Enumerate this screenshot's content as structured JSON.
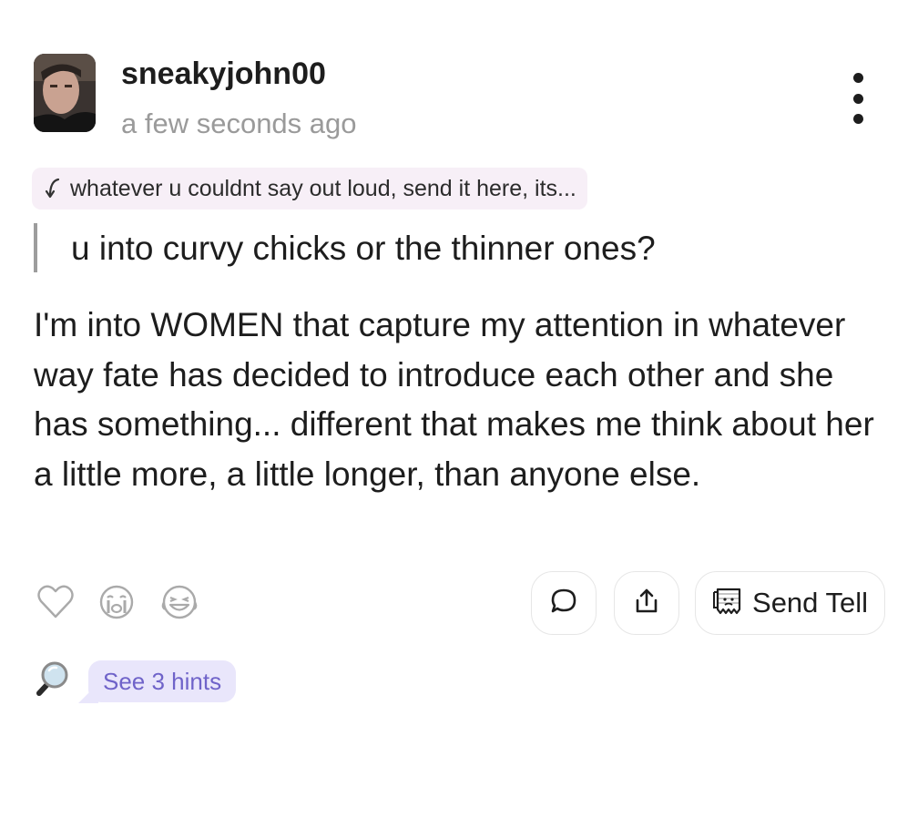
{
  "post": {
    "username": "sneakyjohn00",
    "timestamp": "a few seconds ago",
    "reply_prompt": "whatever u couldnt say out loud, send it here, its...",
    "question": "u into curvy chicks or the thinner ones?",
    "answer": "I'm into WOMEN that capture my attention in whatever way fate has decided to introduce each other and she has something... different that makes me think about her a little more, a little longer, than anyone else."
  },
  "actions": {
    "send_tell_label": "Send Tell"
  },
  "hints": {
    "label": "See 3 hints"
  },
  "icons": {
    "avatar": "user-avatar",
    "menu": "more-vertical-icon",
    "reply": "reply-arrow-icon",
    "heart": "heart-icon",
    "crying": "crying-face-icon",
    "laughing": "laughing-face-icon",
    "comment": "comment-bubble-icon",
    "share": "share-icon",
    "send_tell": "ghost-note-icon",
    "hint": "magnifying-glass-icon"
  },
  "colors": {
    "accent": "#6f63c9",
    "hint_bg": "#e9e6fb",
    "reply_chip_bg": "#f7eff7",
    "muted": "#9a9a9a"
  }
}
